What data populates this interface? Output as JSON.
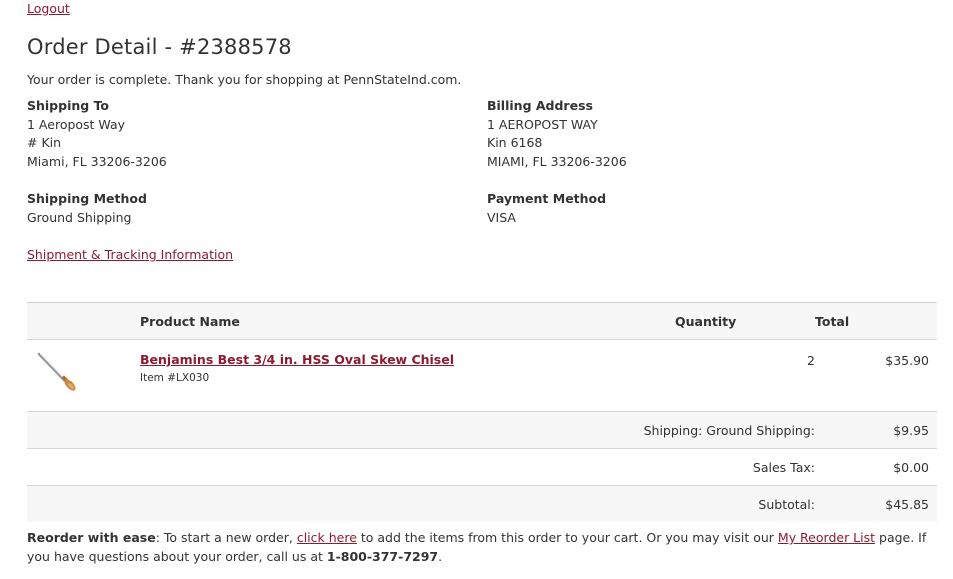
{
  "nav": {
    "logout_label": "Logout"
  },
  "page": {
    "title": "Order Detail - #2388578",
    "intro": "Your order is complete. Thank you for shopping at PennStateInd.com."
  },
  "shipping_to": {
    "label": "Shipping To",
    "line1": "1 Aeropost Way",
    "line2": "# Kin",
    "line3": "Miami, FL 33206-3206"
  },
  "billing": {
    "label": "Billing Address",
    "line1": "1 AEROPOST WAY",
    "line2": "Kin 6168",
    "line3": "MIAMI, FL 33206-3206"
  },
  "shipping_method": {
    "label": "Shipping Method",
    "value": "Ground Shipping"
  },
  "payment_method": {
    "label": "Payment Method",
    "value": "VISA"
  },
  "tracking_link": "Shipment & Tracking Information",
  "table": {
    "headers": {
      "product": "Product Name",
      "quantity": "Quantity",
      "total": "Total"
    },
    "items": [
      {
        "name": "Benjamins Best 3/4 in. HSS Oval Skew Chisel",
        "item_no": "Item #LX030",
        "quantity": "2",
        "total": "$35.90",
        "image_icon": "chisel-icon"
      }
    ],
    "summary": {
      "shipping_label": "Shipping: Ground Shipping:",
      "shipping_value": "$9.95",
      "tax_label": "Sales Tax:",
      "tax_value": "$0.00",
      "subtotal_label": "Subtotal:",
      "subtotal_value": "$45.85"
    }
  },
  "footer": {
    "reorder_bold": "Reorder with ease",
    "text1": ": To start a new order, ",
    "click_here": "click here",
    "text2": " to add the items from this order to your cart. Or you may visit our ",
    "reorder_list": "My Reorder List",
    "text3": " page. If you have questions about your order, call us at ",
    "phone": "1-800-377-7297",
    "text4": "."
  },
  "colors": {
    "link": "#8c1b2f",
    "text": "#333333",
    "shade": "#f7f7f7"
  }
}
